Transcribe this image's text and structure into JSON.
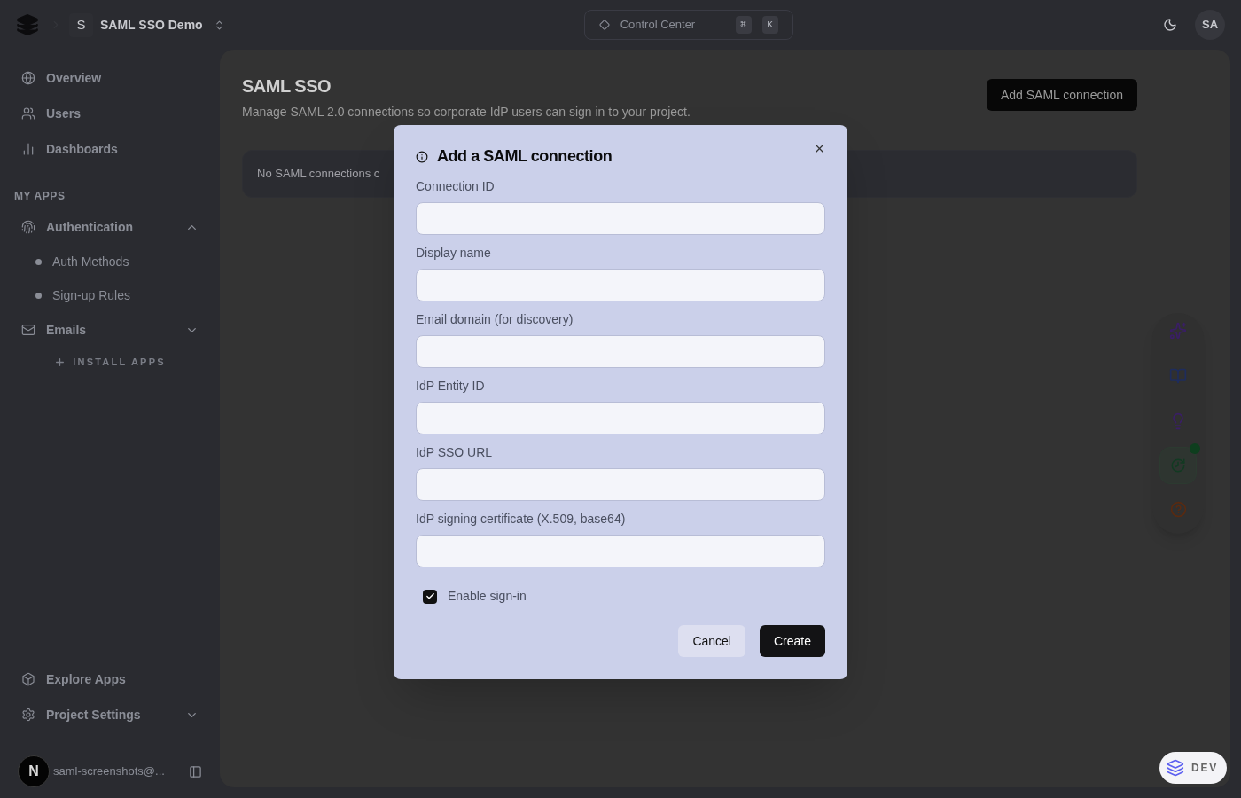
{
  "header": {
    "project_initial": "S",
    "project_name": "SAML SSO Demo",
    "command": {
      "label": "Control Center",
      "keys": [
        "⌘",
        "K"
      ]
    },
    "avatar": "SA"
  },
  "sidebar": {
    "items": [
      {
        "kind": "link",
        "label": "Overview"
      },
      {
        "kind": "link",
        "label": "Users"
      },
      {
        "kind": "link",
        "label": "Dashboards"
      },
      {
        "kind": "heading",
        "label": "MY APPS"
      },
      {
        "kind": "group",
        "label": "Authentication",
        "expanded": true,
        "children": [
          {
            "label": "Auth Methods"
          },
          {
            "label": "Sign-up Rules"
          }
        ]
      },
      {
        "kind": "group",
        "label": "Emails",
        "expanded": false
      },
      {
        "kind": "install",
        "label": "INSTALL APPS"
      }
    ],
    "bottom_items": [
      {
        "kind": "link",
        "label": "Explore Apps"
      },
      {
        "kind": "group",
        "label": "Project Settings",
        "expanded": false
      }
    ],
    "user": {
      "initial": "N",
      "email": "saml-screenshots@..."
    }
  },
  "page": {
    "title": "SAML SSO",
    "subtitle": "Manage SAML 2.0 connections so corporate IdP users can sign in to your project.",
    "action": "Add SAML connection",
    "empty_notice": "No SAML connections c"
  },
  "dialog": {
    "title": "Add a SAML connection",
    "fields": [
      {
        "label": "Connection ID"
      },
      {
        "label": "Display name"
      },
      {
        "label": "Email domain (for discovery)"
      },
      {
        "label": "IdP Entity ID"
      },
      {
        "label": "IdP SSO URL"
      },
      {
        "label": "IdP signing certificate (X.509, base64)"
      }
    ],
    "checkbox": {
      "label": "Enable sign-in",
      "checked": true
    },
    "buttons": [
      {
        "kind": "secondary",
        "label": "Cancel"
      },
      {
        "kind": "primary",
        "label": "Create"
      }
    ]
  },
  "dev_badge": {
    "label": "DEV"
  }
}
